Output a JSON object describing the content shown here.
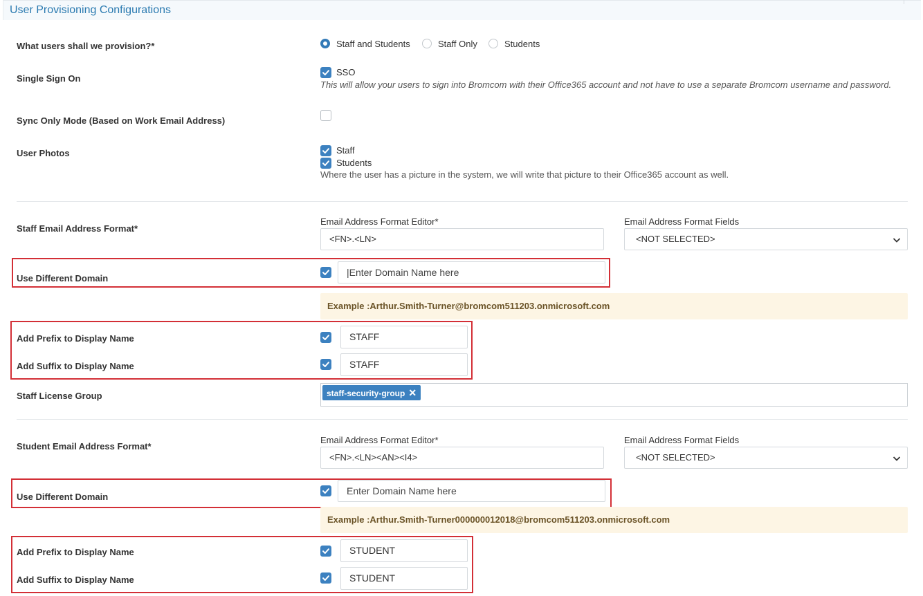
{
  "section_title": "User Provisioning Configurations",
  "provision": {
    "label": "What users shall we provision?*",
    "options": [
      "Staff and Students",
      "Staff Only",
      "Students"
    ],
    "selected": "Staff and Students"
  },
  "sso": {
    "label": "Single Sign On",
    "checkbox_label": "SSO",
    "checked": true,
    "help": "This will allow your users to sign into Bromcom with their Office365 account and not have to use a separate Bromcom username and password."
  },
  "sync_only": {
    "label": "Sync Only Mode (Based on Work Email Address)",
    "checked": false
  },
  "user_photos": {
    "label": "User Photos",
    "options": [
      {
        "label": "Staff",
        "checked": true
      },
      {
        "label": "Students",
        "checked": true
      }
    ],
    "help": "Where the user has a picture in the system, we will write that picture to their Office365 account as well."
  },
  "staff": {
    "email_format_label": "Staff Email Address Format*",
    "editor_label": "Email Address Format Editor*",
    "editor_value": "<FN>.<LN>",
    "fields_label": "Email Address Format Fields",
    "fields_value": "<NOT SELECTED>",
    "domain_label": "Use Different Domain",
    "domain_checked": true,
    "domain_value": "|Enter Domain Name here",
    "example": "Example :Arthur.Smith-Turner@bromcom511203.onmicrosoft.com",
    "prefix_label": "Add Prefix to Display Name",
    "prefix_value": "STAFF",
    "suffix_label": "Add Suffix to Display Name",
    "suffix_value": "STAFF",
    "license_label": "Staff License Group",
    "license_tags": [
      "staff-security-group"
    ]
  },
  "student": {
    "email_format_label": "Student Email Address Format*",
    "editor_label": "Email Address Format Editor*",
    "editor_value": "<FN>.<LN><AN><I4>",
    "fields_label": "Email Address Format Fields",
    "fields_value": "<NOT SELECTED>",
    "domain_label": "Use Different Domain",
    "domain_checked": true,
    "domain_value": "Enter Domain Name here",
    "example": "Example :Arthur.Smith-Turner000000012018@bromcom511203.onmicrosoft.com",
    "prefix_label": "Add Prefix to Display Name",
    "prefix_value": "STUDENT",
    "suffix_label": "Add Suffix to Display Name",
    "suffix_value": "STUDENT"
  },
  "colors": {
    "accent": "#3c81c0",
    "highlight_border": "#d32f36",
    "example_bg": "#fdf5e4",
    "title": "#2a7ab0"
  }
}
